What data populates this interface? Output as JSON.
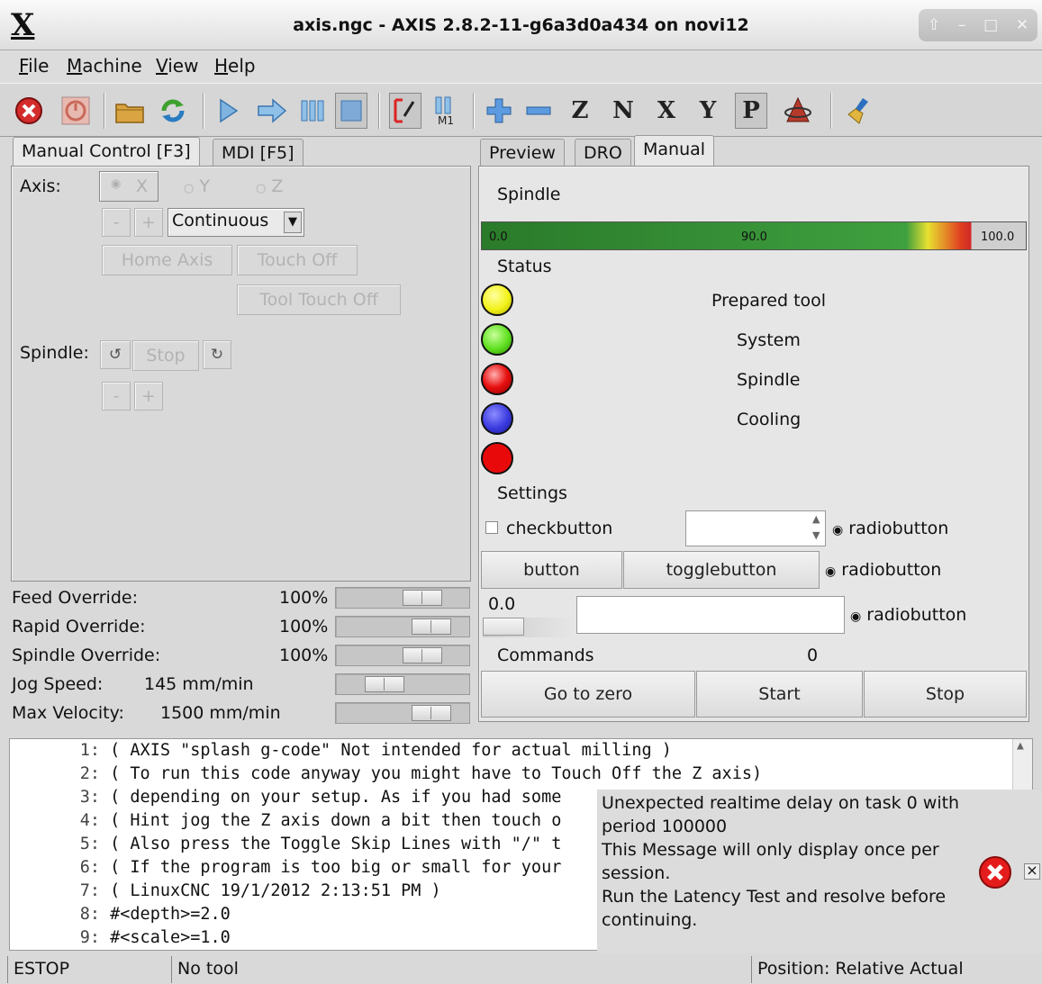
{
  "window": {
    "title": "axis.ngc - AXIS 2.8.2-11-g6a3d0a434 on novi12",
    "logo": "X",
    "controls": [
      "up-icon",
      "minimize-icon",
      "maximize-icon",
      "close-icon"
    ]
  },
  "menubar": {
    "items": [
      {
        "label": "File",
        "mn": "F",
        "rest": "ile"
      },
      {
        "label": "Machine",
        "mn": "M",
        "rest": "achine"
      },
      {
        "label": "View",
        "mn": "V",
        "rest": "iew"
      },
      {
        "label": "Help",
        "mn": "H",
        "rest": "elp"
      }
    ]
  },
  "toolbar": {
    "letters": {
      "z": "Z",
      "n": "N",
      "x": "X",
      "y": "Y",
      "p": "P",
      "m1": "M1"
    }
  },
  "left_tabs": {
    "manual": "Manual Control [F3]",
    "mdi": "MDI [F5]"
  },
  "manual": {
    "axis_label": "Axis:",
    "axes": [
      "X",
      "Y",
      "Z"
    ],
    "selected_axis": "X",
    "minus": "-",
    "plus": "+",
    "jog_mode": "Continuous",
    "home_axis": "Home Axis",
    "touch_off": "Touch Off",
    "tool_touch_off": "Tool Touch Off",
    "spindle_label": "Spindle:",
    "spindle_stop": "Stop",
    "spindle_minus": "-",
    "spindle_plus": "+"
  },
  "overrides": [
    {
      "label": "Feed Override:",
      "value": "100",
      "unit": "%",
      "level": 0.72
    },
    {
      "label": "Rapid Override:",
      "value": "100",
      "unit": "%",
      "level": 0.82
    },
    {
      "label": "Spindle Override:",
      "value": "100",
      "unit": "%",
      "level": 0.72
    }
  ],
  "jog_speed": {
    "label": "Jog Speed:",
    "value": "145 mm/min",
    "level": 0.3
  },
  "max_velocity": {
    "label": "Max Velocity:",
    "value": "1500 mm/min",
    "level": 0.82
  },
  "right_tabs": {
    "preview": "Preview",
    "dro": "DRO",
    "manual": "Manual"
  },
  "gladevcp": {
    "spindle_title": "Spindle",
    "bar": {
      "min": "0.0",
      "mid": "90.0",
      "max": "100.0",
      "colors": {
        "green": "#2e8b2e",
        "yellow": "#f0e030",
        "red": "#e03030"
      }
    },
    "status_title": "Status",
    "leds": [
      {
        "color": "#f2f21a",
        "label": "Prepared tool"
      },
      {
        "color": "#5fe01f",
        "label": "System"
      },
      {
        "color": "#e81010",
        "label": "Spindle"
      },
      {
        "color": "#3a3ae0",
        "label": "Cooling"
      },
      {
        "color": "#e80a0a",
        "label": ""
      }
    ],
    "settings_title": "Settings",
    "checkbutton": "checkbutton",
    "radio1": "radiobutton",
    "radio2": "radiobutton",
    "radio3": "radiobutton",
    "button": "button",
    "togglebutton": "togglebutton",
    "hscale_value": "0.0",
    "commands_label": "Commands",
    "commands_count": "0",
    "go_to_zero": "Go to zero",
    "start": "Start",
    "stop": "Stop"
  },
  "gcode": {
    "lines": [
      {
        "n": "1:",
        "t": "( AXIS \"splash g-code\" Not intended for actual milling )"
      },
      {
        "n": "2:",
        "t": "( To run this code anyway you might have to Touch Off the Z axis)"
      },
      {
        "n": "3:",
        "t": "( depending on your setup. As if you had some"
      },
      {
        "n": "4:",
        "t": "( Hint jog the Z axis down a bit then touch o"
      },
      {
        "n": "5:",
        "t": "( Also press the Toggle Skip Lines with \"/\" t"
      },
      {
        "n": "6:",
        "t": "( If the program is too big or small for your"
      },
      {
        "n": "7:",
        "t": "( LinuxCNC 19/1/2012 2:13:51 PM )"
      },
      {
        "n": "8:",
        "t": "#<depth>=2.0"
      },
      {
        "n": "9:",
        "t": "#<scale>=1.0"
      }
    ]
  },
  "notification": {
    "lines": [
      "Unexpected realtime delay on task 0 with",
      "period 100000",
      "This Message will only display once per",
      "session.",
      "Run the Latency Test and resolve before",
      "continuing."
    ],
    "close": "×"
  },
  "statusbar": {
    "estop": "ESTOP",
    "tool": "No tool",
    "position": "Position: Relative Actual"
  }
}
